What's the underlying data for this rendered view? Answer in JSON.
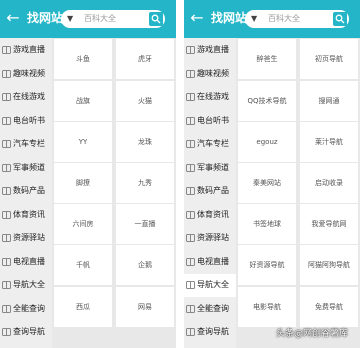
{
  "left": {
    "title": "找网站",
    "search_placeholder": "百科大全",
    "sidebar": [
      {
        "label": "游戏直播"
      },
      {
        "label": "趣味视频"
      },
      {
        "label": "在线游戏"
      },
      {
        "label": "电台听书"
      },
      {
        "label": "汽车专栏"
      },
      {
        "label": "军事频道"
      },
      {
        "label": "数码产品"
      },
      {
        "label": "体育资讯"
      },
      {
        "label": "资源驿站"
      },
      {
        "label": "电视直播"
      },
      {
        "label": "导航大全"
      },
      {
        "label": "全能查询"
      },
      {
        "label": "查询导航"
      }
    ],
    "sites": [
      {
        "label": "斗鱼"
      },
      {
        "label": "虎牙"
      },
      {
        "label": "战旗"
      },
      {
        "label": "火猫"
      },
      {
        "label": "YY"
      },
      {
        "label": "龙珠"
      },
      {
        "label": "脚撩"
      },
      {
        "label": "九秀"
      },
      {
        "label": "六间房"
      },
      {
        "label": "一直播"
      },
      {
        "label": "千帆"
      },
      {
        "label": "企鹅"
      },
      {
        "label": "西瓜"
      },
      {
        "label": "网易"
      }
    ]
  },
  "right": {
    "title": "找网站",
    "search_placeholder": "百科大全",
    "active_index": 10,
    "sidebar": [
      {
        "label": "游戏直播"
      },
      {
        "label": "趣味视频"
      },
      {
        "label": "在线游戏"
      },
      {
        "label": "电台听书"
      },
      {
        "label": "汽车专栏"
      },
      {
        "label": "军事频道"
      },
      {
        "label": "数码产品"
      },
      {
        "label": "体育资讯"
      },
      {
        "label": "资源驿站"
      },
      {
        "label": "电视直播"
      },
      {
        "label": "导航大全"
      },
      {
        "label": "全能查询"
      },
      {
        "label": "查询导航"
      }
    ],
    "sites": [
      {
        "label": "醉爸生"
      },
      {
        "label": "初页导航"
      },
      {
        "label": "QQ技术导航"
      },
      {
        "label": "搜网通"
      },
      {
        "label": "egouz"
      },
      {
        "label": "莱汁导航"
      },
      {
        "label": "秦美网站"
      },
      {
        "label": "启动收录"
      },
      {
        "label": "书签地球"
      },
      {
        "label": "我爱导航网"
      },
      {
        "label": "好资源导航"
      },
      {
        "label": "阿猫阿狗导航"
      },
      {
        "label": "电影导航"
      },
      {
        "label": "免费导航"
      }
    ]
  },
  "watermark": "头条@网创谷薯库",
  "colors": {
    "accent": "#24b6c8",
    "sidebar_bg": "#eeeeee",
    "grid_line": "#e8e8e8"
  }
}
